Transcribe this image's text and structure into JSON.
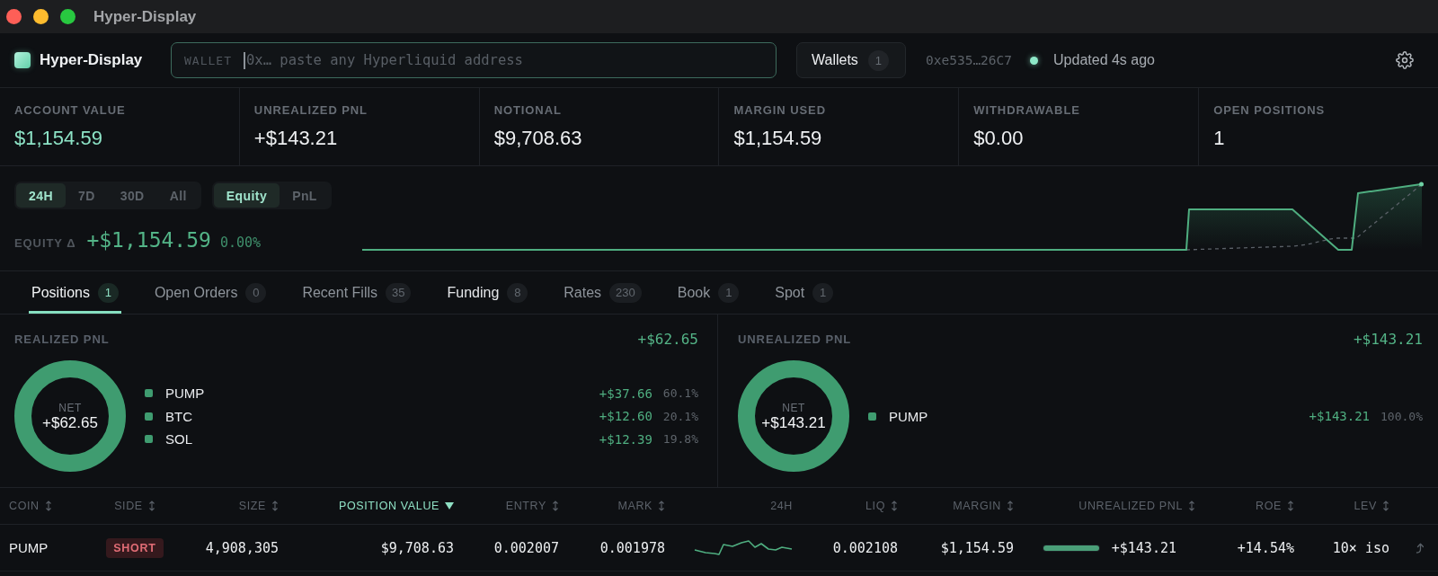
{
  "window": {
    "title": "Hyper-Display"
  },
  "header": {
    "brand": "Hyper-Display",
    "wallet_field": {
      "label": "WALLET",
      "placeholder": "0x… paste any Hyperliquid address",
      "focused": true
    },
    "wallets_button": {
      "label": "Wallets",
      "count": "1"
    },
    "address": "0xe535…26C7",
    "live": true,
    "updated": "Updated 4s ago"
  },
  "stats": [
    {
      "label": "ACCOUNT VALUE",
      "value": "$1,154.59",
      "highlighted": true
    },
    {
      "label": "UNREALIZED PNL",
      "value": "+$143.21",
      "highlighted": false
    },
    {
      "label": "NOTIONAL",
      "value": "$9,708.63",
      "highlighted": false
    },
    {
      "label": "MARGIN USED",
      "value": "$1,154.59",
      "highlighted": false
    },
    {
      "label": "WITHDRAWABLE",
      "value": "$0.00",
      "highlighted": false
    },
    {
      "label": "OPEN POSITIONS",
      "value": "1",
      "highlighted": false
    }
  ],
  "equity": {
    "ranges": [
      {
        "label": "24H",
        "selected": true
      },
      {
        "label": "7D",
        "selected": false
      },
      {
        "label": "30D",
        "selected": false
      },
      {
        "label": "All",
        "selected": false
      }
    ],
    "metrics": [
      {
        "label": "Equity",
        "selected": true
      },
      {
        "label": "PnL",
        "selected": false
      }
    ],
    "delta_label": "EQUITY Δ",
    "delta_value": "+$1,154.59",
    "delta_percent": "0.00%"
  },
  "tabs": [
    {
      "label": "Positions",
      "count": "1",
      "selected": true,
      "hovered": false
    },
    {
      "label": "Open Orders",
      "count": "0",
      "selected": false,
      "hovered": false
    },
    {
      "label": "Recent Fills",
      "count": "35",
      "selected": false,
      "hovered": false
    },
    {
      "label": "Funding",
      "count": "8",
      "selected": false,
      "hovered": true
    },
    {
      "label": "Rates",
      "count": "230",
      "selected": false,
      "hovered": false
    },
    {
      "label": "Book",
      "count": "1",
      "selected": false,
      "hovered": false
    },
    {
      "label": "Spot",
      "count": "1",
      "selected": false,
      "hovered": false
    }
  ],
  "pnl_panels": [
    {
      "title": "REALIZED PNL",
      "total": "+$62.65",
      "center_label": "NET",
      "center_value": "+$62.65",
      "items": [
        {
          "name": "PUMP",
          "amount": "+$37.66",
          "share": "60.1%"
        },
        {
          "name": "BTC",
          "amount": "+$12.60",
          "share": "20.1%"
        },
        {
          "name": "SOL",
          "amount": "+$12.39",
          "share": "19.8%"
        }
      ]
    },
    {
      "title": "UNREALIZED PNL",
      "total": "+$143.21",
      "center_label": "NET",
      "center_value": "+$143.21",
      "items": [
        {
          "name": "PUMP",
          "amount": "+$143.21",
          "share": "100.0%"
        }
      ]
    }
  ],
  "table": {
    "columns": [
      {
        "label": "COIN",
        "sortable": true,
        "sorted": false
      },
      {
        "label": "SIDE",
        "sortable": true,
        "sorted": false
      },
      {
        "label": "SIZE",
        "sortable": true,
        "sorted": false
      },
      {
        "label": "POSITION VALUE",
        "sortable": true,
        "sorted": true
      },
      {
        "label": "ENTRY",
        "sortable": true,
        "sorted": false
      },
      {
        "label": "MARK",
        "sortable": true,
        "sorted": false
      },
      {
        "label": "24H",
        "sortable": false,
        "sorted": false
      },
      {
        "label": "LIQ",
        "sortable": true,
        "sorted": false
      },
      {
        "label": "MARGIN",
        "sortable": true,
        "sorted": false
      },
      {
        "label": "UNREALIZED PNL",
        "sortable": true,
        "sorted": false
      },
      {
        "label": "ROE",
        "sortable": true,
        "sorted": false
      },
      {
        "label": "LEV",
        "sortable": true,
        "sorted": false
      }
    ],
    "rows": [
      {
        "coin": "PUMP",
        "side": {
          "label": "SHORT",
          "kind": "short"
        },
        "size": "4,908,305",
        "position_value": "$9,708.63",
        "entry": "0.002007",
        "mark": "0.001978",
        "liq": "0.002108",
        "margin": "$1,154.59",
        "unrealized_pnl": "+$143.21",
        "roe": "+14.54%",
        "lev": "10× iso"
      }
    ]
  }
}
